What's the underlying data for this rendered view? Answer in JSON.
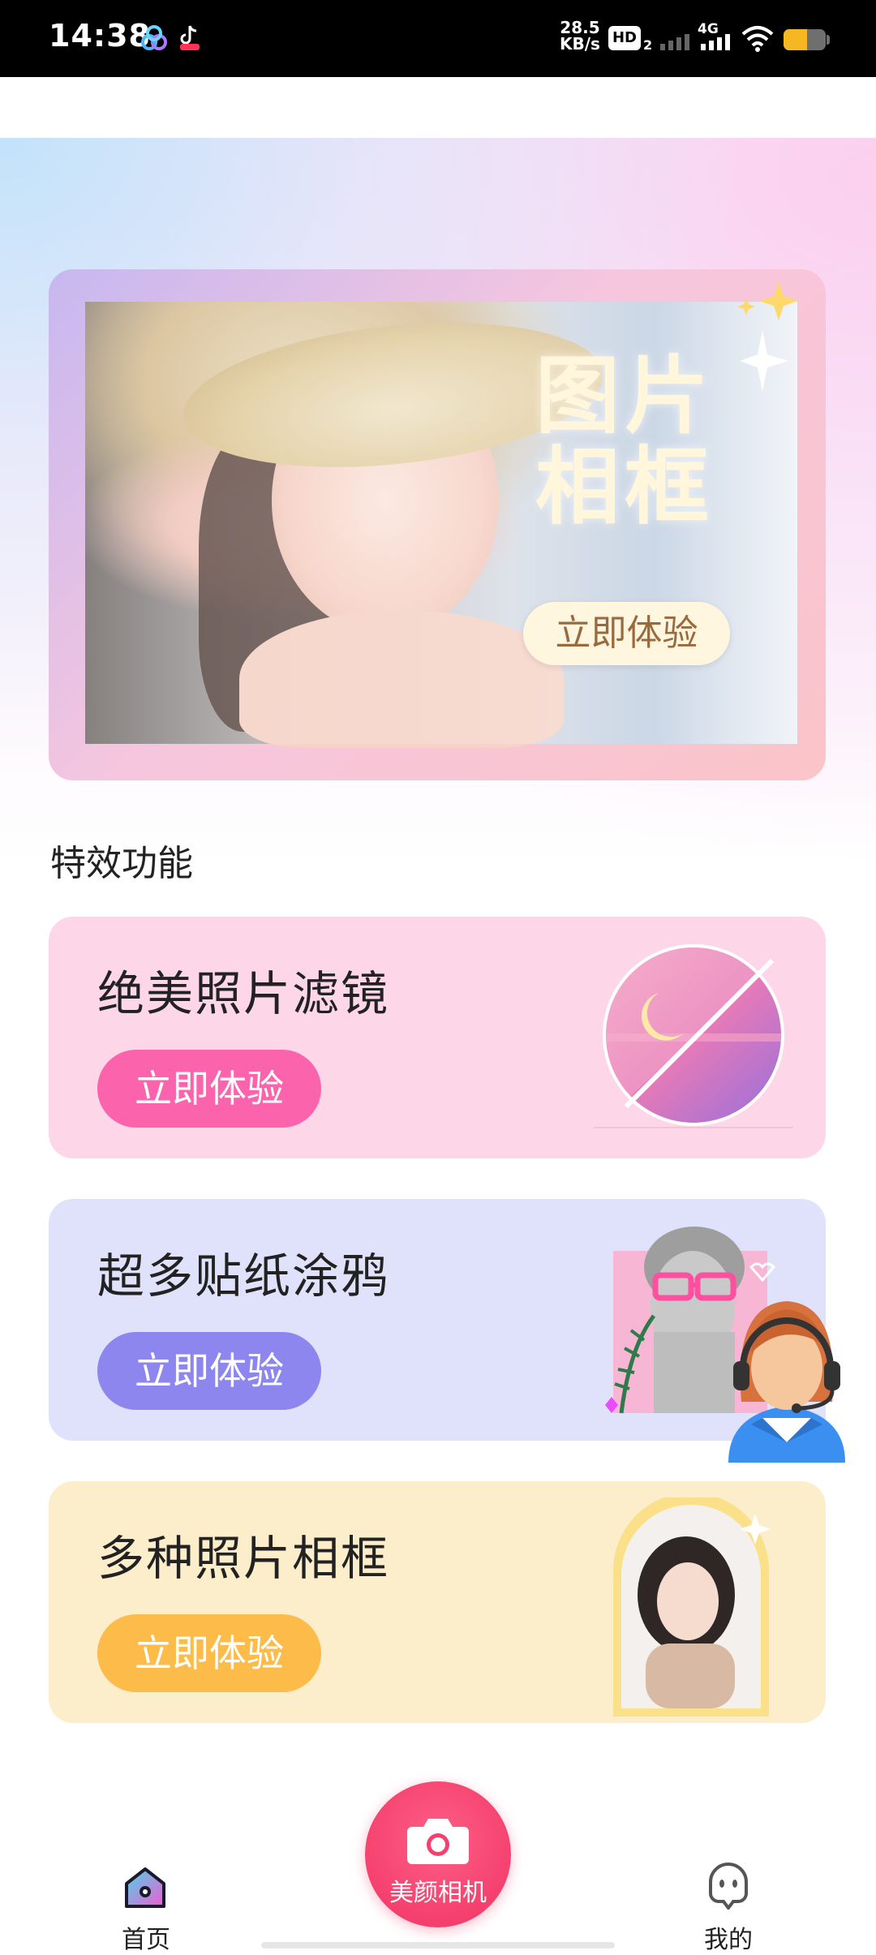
{
  "status_bar": {
    "time": "14:38",
    "net_speed_value": "28.5",
    "net_speed_unit": "KB/s",
    "hd_label": "HD",
    "hd_sub": "2",
    "network_type": "4G",
    "battery_level": 0.55
  },
  "banner": {
    "title_line1": "图片",
    "title_line2": "相框",
    "button_label": "立即体验"
  },
  "section": {
    "title": "特效功能"
  },
  "features": [
    {
      "title": "绝美照片滤镜",
      "button": "立即体验",
      "color": "#fb64ad",
      "bg": "#fdd6e8"
    },
    {
      "title": "超多贴纸涂鸦",
      "button": "立即体验",
      "color": "#8d86ef",
      "bg": "#e0e2fb"
    },
    {
      "title": "多种照片相框",
      "button": "立即体验",
      "color": "#fdbb49",
      "bg": "#fdeecb"
    }
  ],
  "bottom_nav": {
    "home_label": "首页",
    "camera_label": "美颜相机",
    "mine_label": "我的"
  },
  "icons": {
    "home": "home-icon",
    "camera": "camera-icon",
    "mine": "robot-face-icon",
    "service": "customer-service-avatar"
  }
}
